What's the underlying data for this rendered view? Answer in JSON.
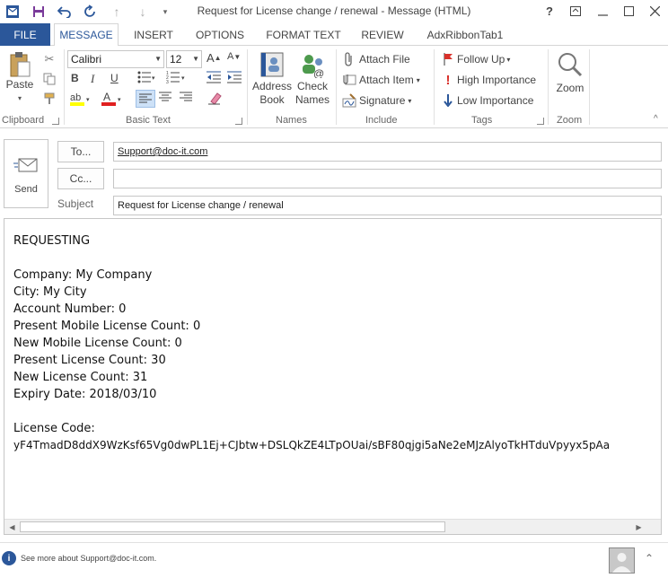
{
  "window": {
    "title": "Request for License change / renewal - Message (HTML)"
  },
  "tabs": [
    {
      "label": "FILE"
    },
    {
      "label": "MESSAGE"
    },
    {
      "label": "INSERT"
    },
    {
      "label": "OPTIONS"
    },
    {
      "label": "FORMAT TEXT"
    },
    {
      "label": "REVIEW"
    },
    {
      "label": "AdxRibbonTab1"
    }
  ],
  "ribbon": {
    "clipboard": {
      "label": "Clipboard",
      "paste": "Paste"
    },
    "basic_text": {
      "label": "Basic Text",
      "font": "Calibri",
      "size": "12"
    },
    "names": {
      "label": "Names",
      "address_book_1": "Address",
      "address_book_2": "Book",
      "check_names_1": "Check",
      "check_names_2": "Names"
    },
    "include": {
      "label": "Include",
      "attach_file": "Attach File",
      "attach_item": "Attach Item",
      "signature": "Signature"
    },
    "tags": {
      "label": "Tags",
      "follow_up": "Follow Up",
      "high_importance": "High Importance",
      "low_importance": "Low Importance"
    },
    "zoom": {
      "label": "Zoom",
      "zoom": "Zoom"
    }
  },
  "header": {
    "send": "Send",
    "to_button": "To...",
    "to_value": "Support@doc-it.com",
    "cc_button": "Cc...",
    "cc_value": "",
    "subject_label": "Subject",
    "subject_value": "Request for License change / renewal"
  },
  "body": {
    "lines": [
      "REQUESTING",
      "",
      "Company: My Company",
      "City: My City",
      "Account Number: 0",
      "Present Mobile License Count: 0",
      "New Mobile License Count: 0",
      "Present License Count: 30",
      "New License Count: 31",
      "Expiry Date: 2018/03/10",
      "",
      "License Code:",
      "yF4TmadD8ddX9WzKsf65Vg0dwPL1Ej+CJbtw+DSLQkZE4LTpOUai/sBF80qjgi5aNe2eMJzAlyoTkHTduVpyyx5pAa"
    ]
  },
  "footer": {
    "text": "See more about Support@doc-it.com."
  },
  "colors": {
    "accent": "#2b579a"
  }
}
